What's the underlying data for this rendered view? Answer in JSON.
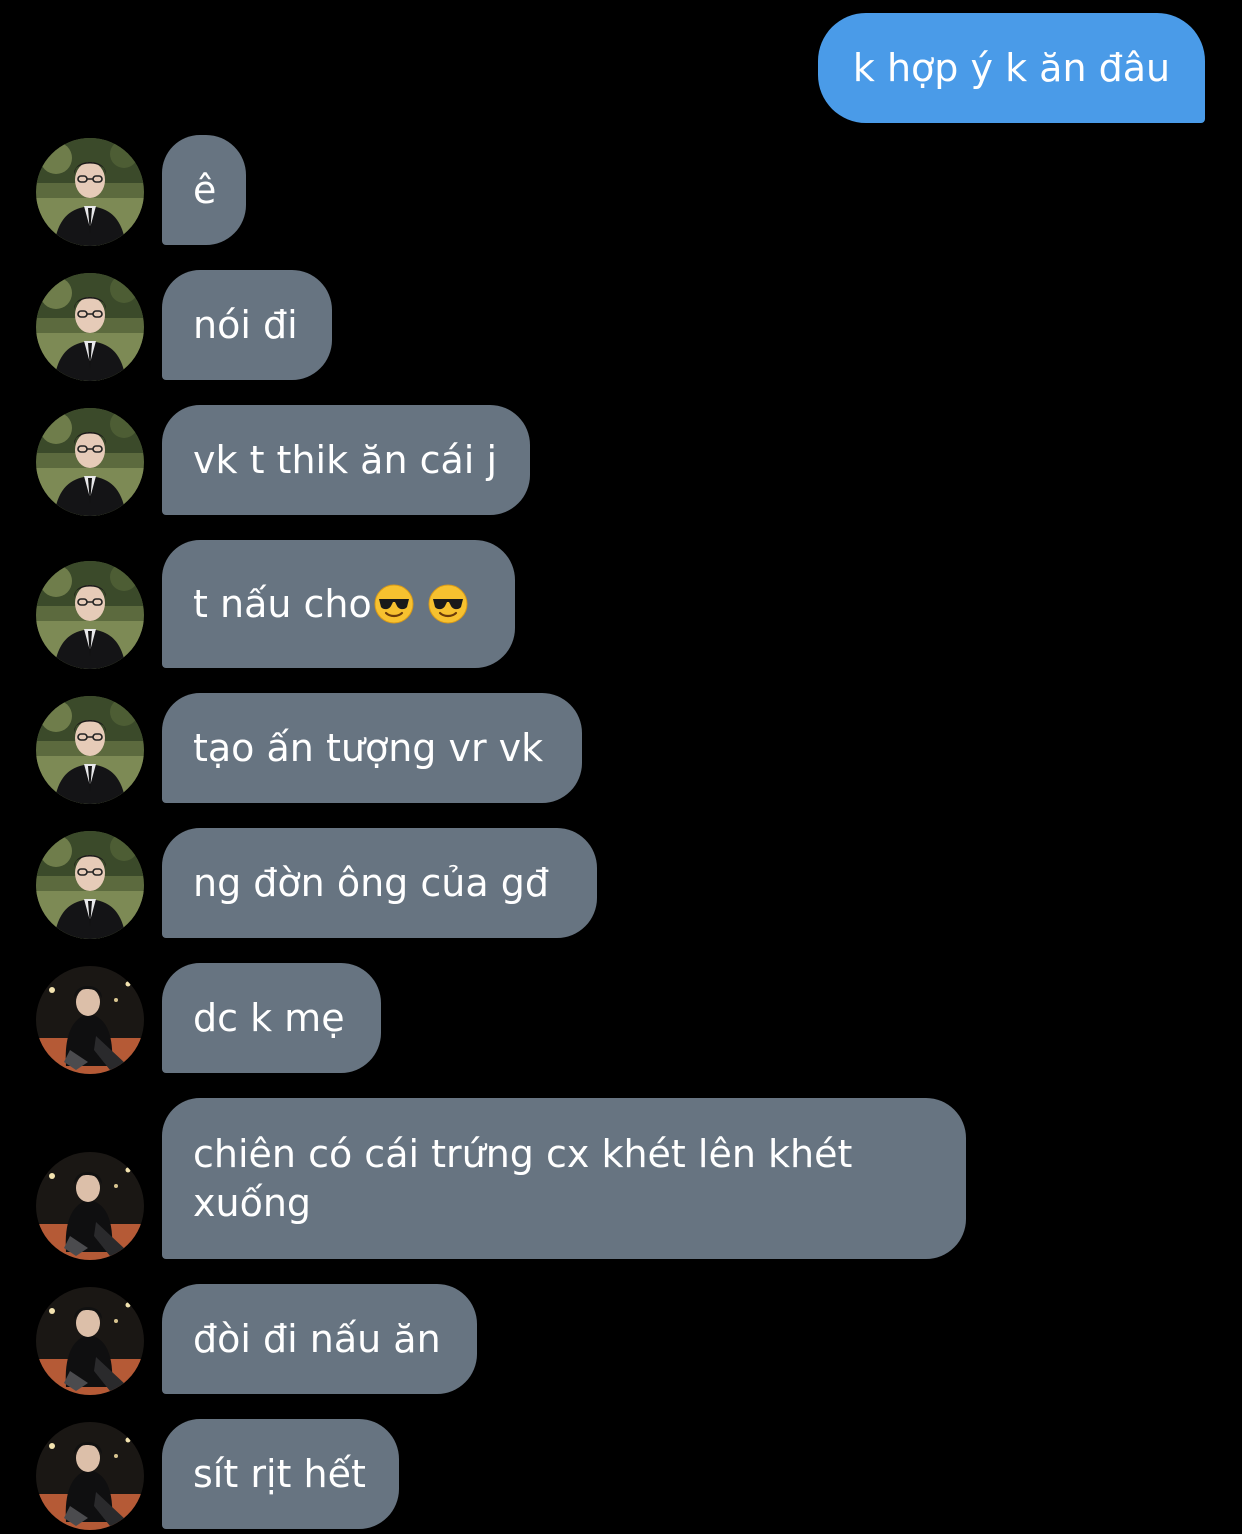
{
  "conversation": {
    "outgoing": [
      {
        "text": "k hợp ý k ăn đâu"
      }
    ],
    "incoming": [
      {
        "text": "ê",
        "avatar": "avatar-suit"
      },
      {
        "text": "nói đi",
        "avatar": "avatar-suit"
      },
      {
        "text": "vk t thik ăn cái j",
        "avatar": "avatar-suit"
      },
      {
        "text": "t nấu cho",
        "emoji": "sunglasses-emoji",
        "avatar": "avatar-suit"
      },
      {
        "text": "tạo ấn tượng vr vk",
        "avatar": "avatar-suit"
      },
      {
        "text": "ng đờn ông của gđ",
        "avatar": "avatar-suit"
      },
      {
        "text": "dc k mẹ",
        "avatar": "avatar-leather"
      },
      {
        "text": "chiên có cái trứng cx khét lên khét xuống",
        "avatar": "avatar-leather"
      },
      {
        "text": "đòi đi nấu ăn",
        "avatar": "avatar-leather"
      },
      {
        "text": "sít rịt hết",
        "avatar": "avatar-leather"
      }
    ]
  },
  "colors": {
    "background": "#000000",
    "outgoing_bubble": "#4a9be8",
    "incoming_bubble": "#677481",
    "text": "#ffffff"
  }
}
